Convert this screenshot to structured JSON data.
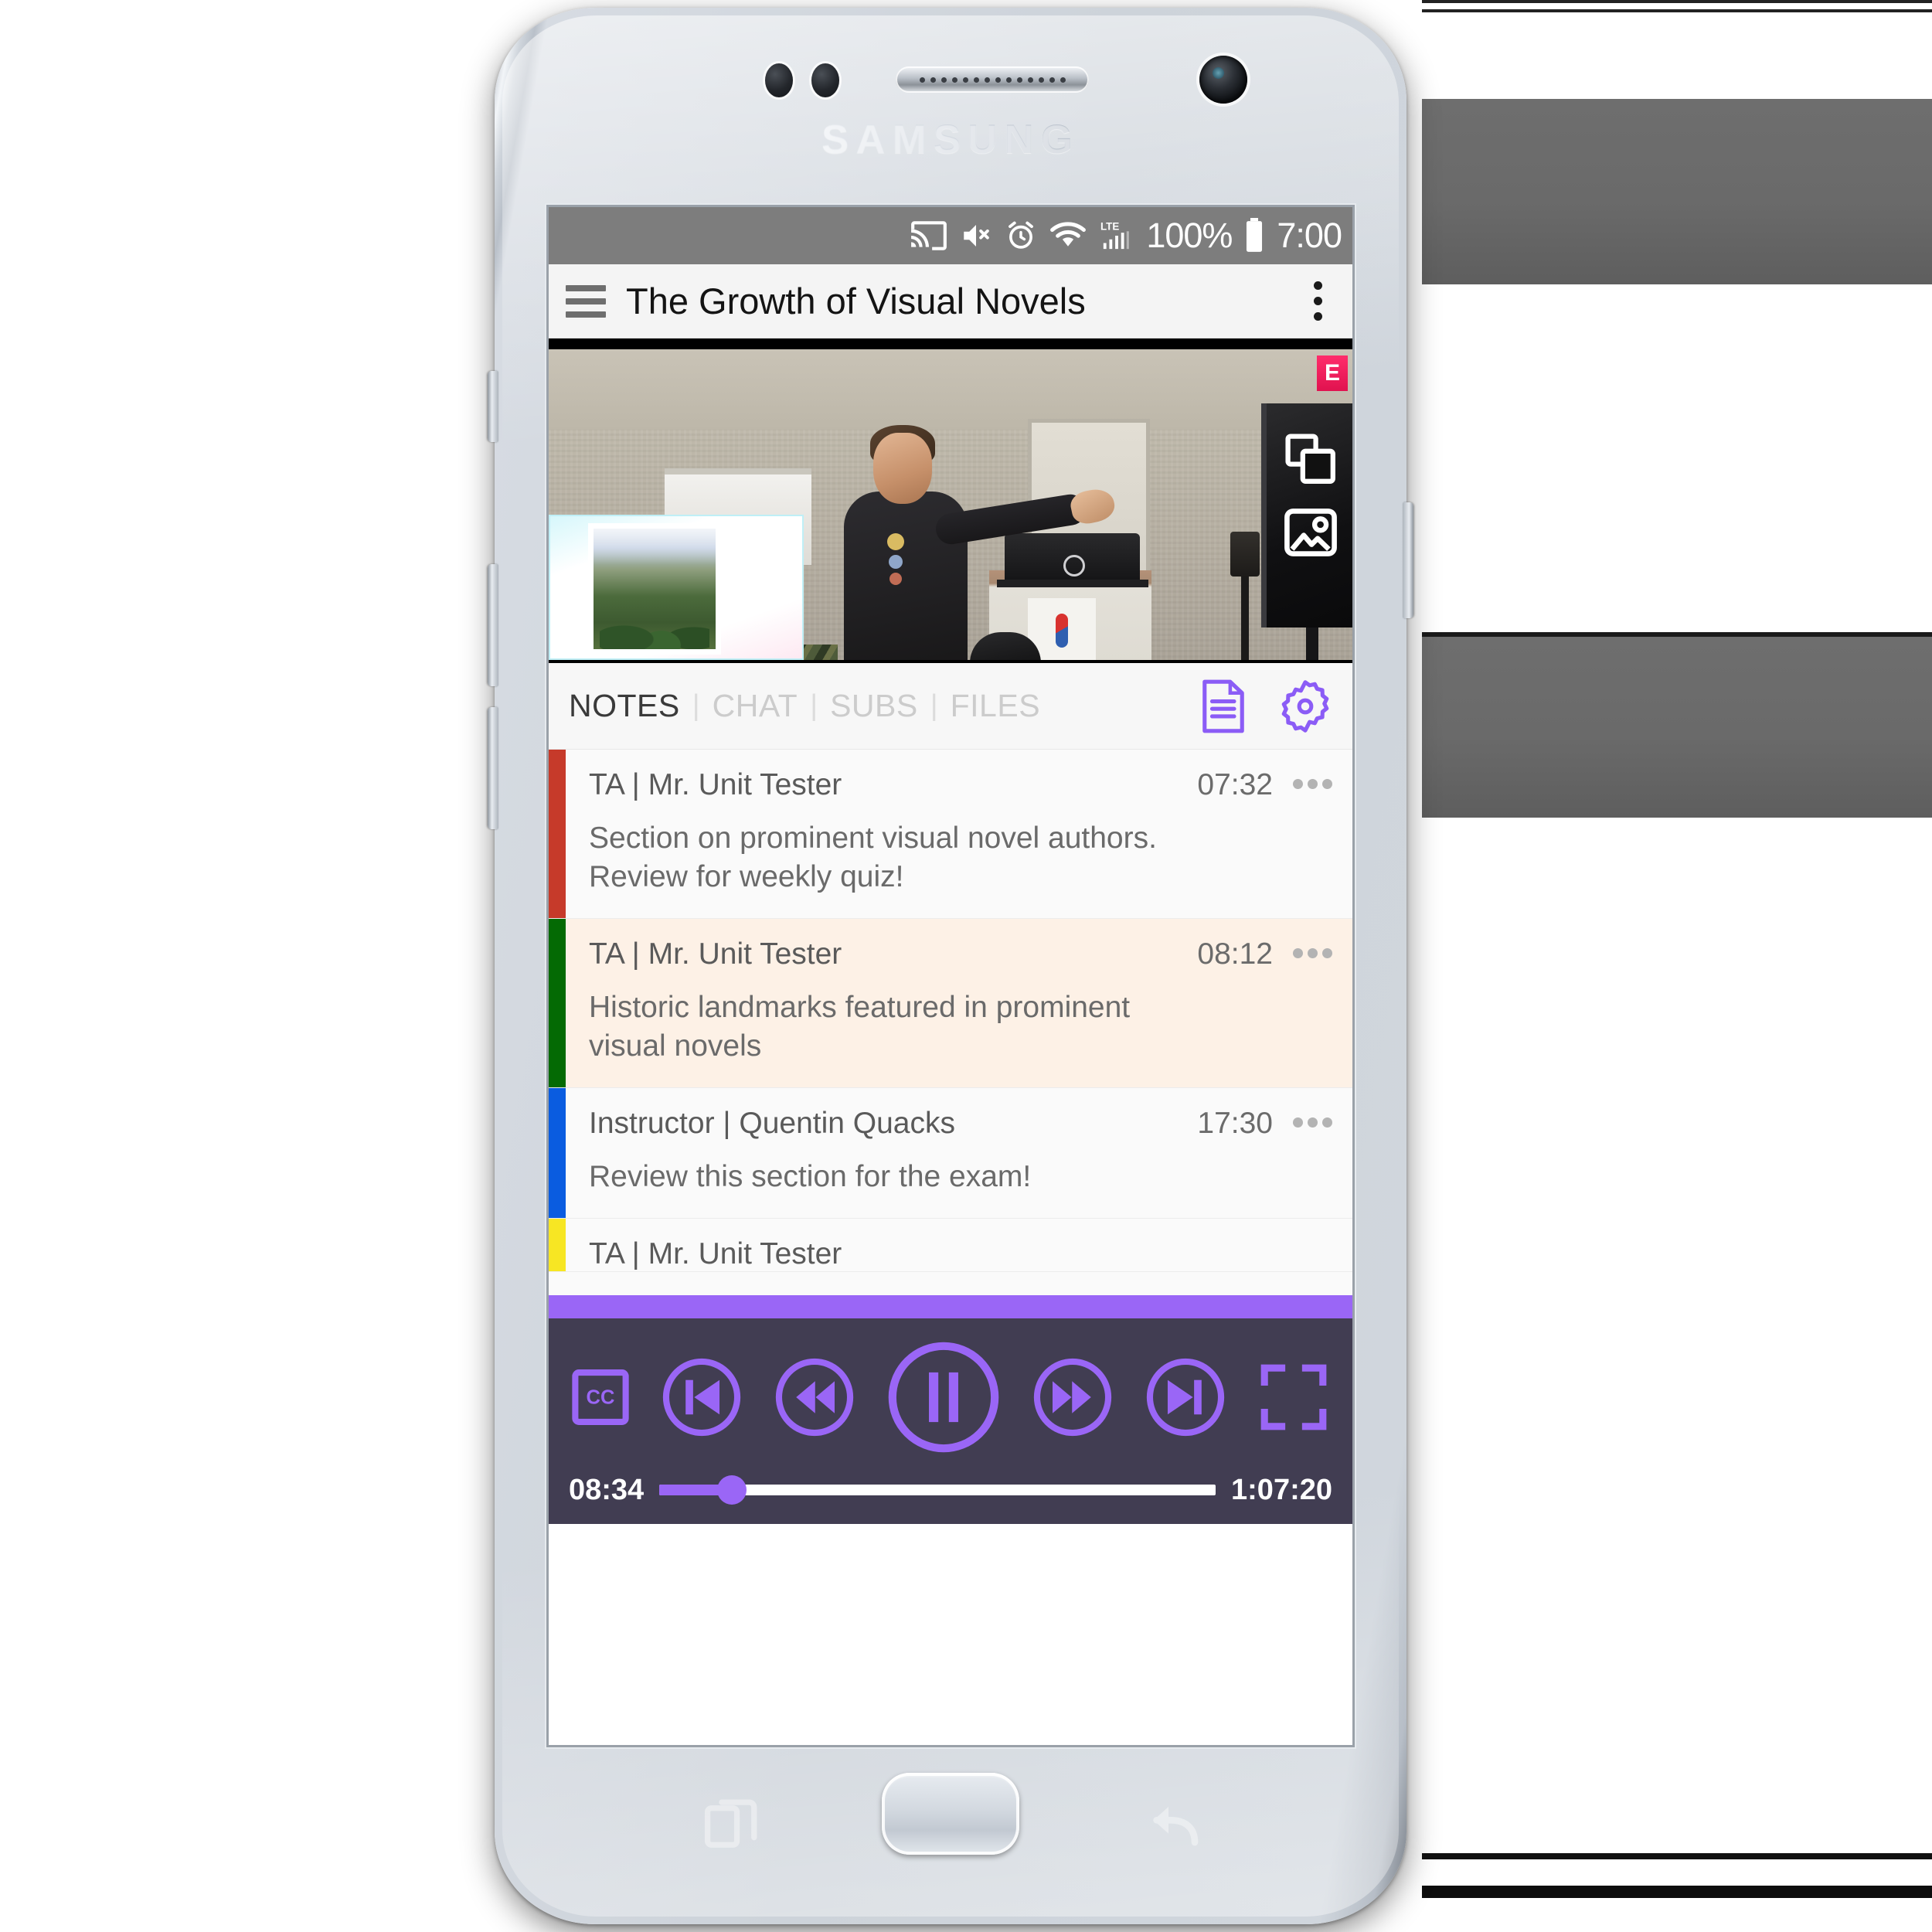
{
  "device": {
    "brand": "SAMSUNG",
    "icons": {
      "earpiece": "speaker-grille",
      "front_camera": "front-camera",
      "sensors": "proximity-sensor",
      "home": "home-button",
      "recent": "recent-apps-icon",
      "back": "back-icon"
    }
  },
  "status_bar": {
    "battery_percent": "100%",
    "clock": "7:00",
    "network_type": "LTE",
    "icons": [
      "cast-icon",
      "mute-icon",
      "alarm-icon",
      "wifi-icon",
      "signal-icon",
      "battery-icon"
    ],
    "background": "#7d7d7d"
  },
  "app_bar": {
    "menu_icon": "hamburger-icon",
    "title": "The Growth of Visual Novels",
    "overflow_icon": "overflow-menu-icon"
  },
  "video": {
    "overlay_icons": [
      "copy-layers-icon",
      "image-icon"
    ],
    "pip_label": "slide-thumbnail"
  },
  "tabs": {
    "items": [
      {
        "label": "NOTES",
        "active": true
      },
      {
        "label": "CHAT",
        "active": false
      },
      {
        "label": "SUBS",
        "active": false
      },
      {
        "label": "FILES",
        "active": false
      }
    ],
    "separator": "|",
    "actions": [
      {
        "name": "document-icon",
        "color": "#8b5cf6"
      },
      {
        "name": "gear-icon",
        "color": "#8b5cf6"
      }
    ]
  },
  "notes": [
    {
      "author": "TA | Mr. Unit Tester",
      "time": "07:32",
      "text": "Section on prominent visual novel authors.\nReview for weekly quiz!",
      "accent": "#c63a2a",
      "background": "#fafafa"
    },
    {
      "author": "TA | Mr. Unit Tester",
      "time": "08:12",
      "text": "Historic landmarks featured in prominent\nvisual novels",
      "accent": "#046a04",
      "background": "#fdf1e6"
    },
    {
      "author": "Instructor | Quentin Quacks",
      "time": "17:30",
      "text": "Review this section for the exam!",
      "accent": "#0a5ce0",
      "background": "#fafafa"
    },
    {
      "author": "TA | Mr. Unit Tester",
      "time": "",
      "text": "",
      "accent": "#f7e623",
      "background": "#fafafa"
    }
  ],
  "player": {
    "divider_color": "#9a66f6",
    "background": "#413d52",
    "accent": "#9a66f6",
    "buttons": [
      {
        "name": "cc-button",
        "label": "CC"
      },
      {
        "name": "skip-previous-button",
        "label": ""
      },
      {
        "name": "rewind-button",
        "label": ""
      },
      {
        "name": "pause-button",
        "label": ""
      },
      {
        "name": "fast-forward-button",
        "label": ""
      },
      {
        "name": "skip-next-button",
        "label": ""
      },
      {
        "name": "fullscreen-button",
        "label": ""
      }
    ],
    "current_time": "08:34",
    "total_time": "1:07:20",
    "progress_percent": 13
  }
}
